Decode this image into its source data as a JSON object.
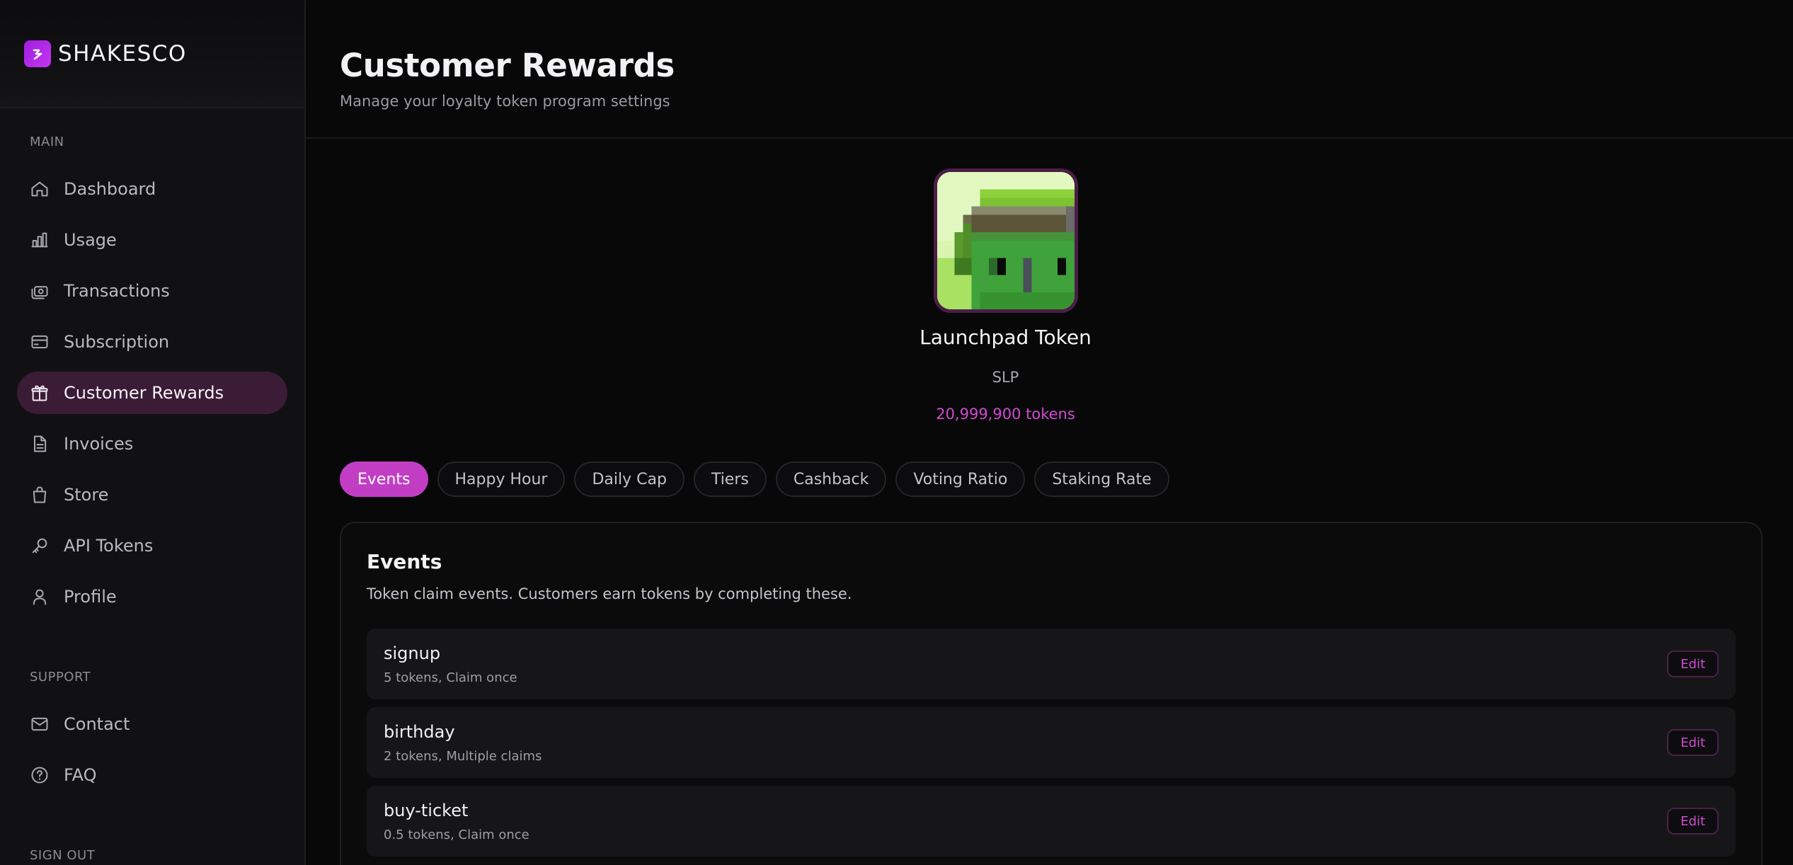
{
  "brand": {
    "name": "SHAKESCO"
  },
  "sidebar": {
    "main_label": "MAIN",
    "items": [
      {
        "label": "Dashboard",
        "icon": "home-icon"
      },
      {
        "label": "Usage",
        "icon": "bar-chart-icon"
      },
      {
        "label": "Transactions",
        "icon": "cash-icon"
      },
      {
        "label": "Subscription",
        "icon": "credit-card-icon"
      },
      {
        "label": "Customer Rewards",
        "icon": "gift-icon",
        "active": true
      },
      {
        "label": "Invoices",
        "icon": "document-icon"
      },
      {
        "label": "Store",
        "icon": "shopping-bag-icon"
      },
      {
        "label": "API Tokens",
        "icon": "key-icon"
      },
      {
        "label": "Profile",
        "icon": "user-icon"
      }
    ],
    "support_label": "SUPPORT",
    "support_items": [
      {
        "label": "Contact",
        "icon": "mail-icon"
      },
      {
        "label": "FAQ",
        "icon": "help-circle-icon"
      }
    ],
    "signout_label": "SIGN OUT"
  },
  "header": {
    "title": "Customer Rewards",
    "subtitle": "Manage your loyalty token program settings"
  },
  "token": {
    "name": "Launchpad Token",
    "symbol": "SLP",
    "supply": "20,999,900 tokens"
  },
  "tabs": [
    {
      "label": "Events",
      "active": true
    },
    {
      "label": "Happy Hour"
    },
    {
      "label": "Daily Cap"
    },
    {
      "label": "Tiers"
    },
    {
      "label": "Cashback"
    },
    {
      "label": "Voting Ratio"
    },
    {
      "label": "Staking Rate"
    }
  ],
  "events_panel": {
    "title": "Events",
    "description": "Token claim events. Customers earn tokens by completing these.",
    "edit_label": "Edit",
    "events": [
      {
        "name": "signup",
        "meta": "5 tokens, Claim once"
      },
      {
        "name": "birthday",
        "meta": "2 tokens, Multiple claims"
      },
      {
        "name": "buy-ticket",
        "meta": "0.5 tokens, Claim once"
      }
    ]
  },
  "colors": {
    "accent": "#c13ec4",
    "accent_text": "#d24ad1",
    "active_nav_bg": "#3a1c36",
    "background": "#080809",
    "sidebar_bg": "#111113"
  }
}
